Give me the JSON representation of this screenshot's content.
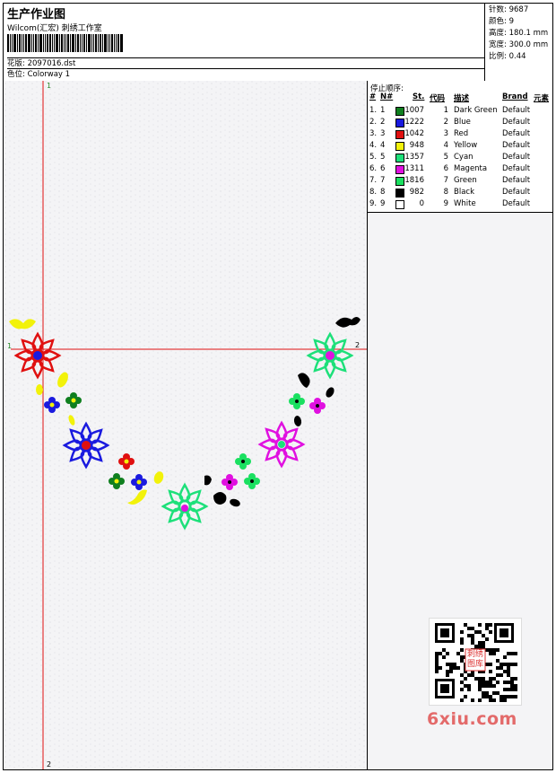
{
  "header": {
    "title": "生产作业图",
    "company": "Wilcom(汇宏) 刺绣工作室",
    "design_label": "花版: 2097016.dst",
    "colorway_label": "色位: Colorway 1"
  },
  "stats": [
    {
      "label": "针数",
      "value": "9687"
    },
    {
      "label": "颜色",
      "value": "9"
    },
    {
      "label": "高度",
      "value": "180.1 mm"
    },
    {
      "label": "宽度",
      "value": "300.0 mm"
    },
    {
      "label": "比例",
      "value": "0.44"
    }
  ],
  "stops": {
    "title": "停止顺序:",
    "headers": {
      "num": "#",
      "n": "N#",
      "st": "St.",
      "code": "代码",
      "desc": "描述",
      "brand": "Brand",
      "elem": "元素"
    },
    "rows": [
      {
        "num": "1.",
        "n": "1",
        "color": "#0f7f1f",
        "st": "1007",
        "code": "1",
        "desc": "Dark Green",
        "brand": "Default"
      },
      {
        "num": "2.",
        "n": "2",
        "color": "#1a1adf",
        "st": "1222",
        "code": "2",
        "desc": "Blue",
        "brand": "Default"
      },
      {
        "num": "3.",
        "n": "3",
        "color": "#e01010",
        "st": "1042",
        "code": "3",
        "desc": "Red",
        "brand": "Default"
      },
      {
        "num": "4.",
        "n": "4",
        "color": "#f2f20a",
        "st": "948",
        "code": "4",
        "desc": "Yellow",
        "brand": "Default"
      },
      {
        "num": "5.",
        "n": "5",
        "color": "#1de07a",
        "st": "1357",
        "code": "5",
        "desc": "Cyan",
        "brand": "Default"
      },
      {
        "num": "6.",
        "n": "6",
        "color": "#e010e0",
        "st": "1311",
        "code": "6",
        "desc": "Magenta",
        "brand": "Default"
      },
      {
        "num": "7.",
        "n": "7",
        "color": "#1ae060",
        "st": "1816",
        "code": "7",
        "desc": "Green",
        "brand": "Default"
      },
      {
        "num": "8.",
        "n": "8",
        "color": "#000000",
        "st": "982",
        "code": "8",
        "desc": "Black",
        "brand": "Default"
      },
      {
        "num": "9.",
        "n": "9",
        "color": "#ffffff",
        "st": "0",
        "code": "9",
        "desc": "White",
        "brand": "Default"
      }
    ]
  },
  "axes": {
    "v_top": "1",
    "v_bottom": "2",
    "h_left": "1",
    "h_right": "2"
  },
  "watermark": {
    "text": "6xiu.com",
    "seal": "刺绣图库"
  },
  "colors": {
    "guide": "#e01010",
    "border": "#000000",
    "watermark": "#e36a6a"
  }
}
